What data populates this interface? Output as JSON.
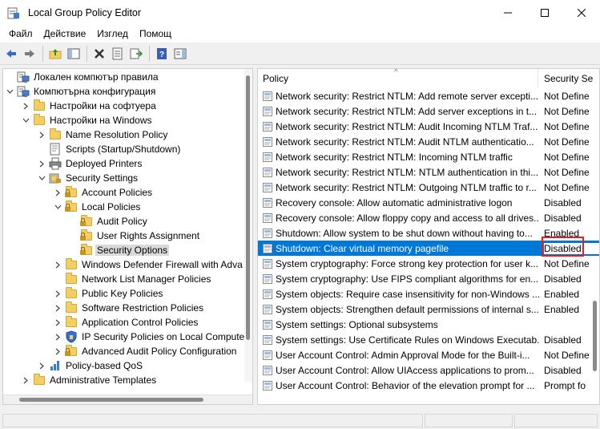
{
  "window": {
    "title": "Local Group Policy Editor"
  },
  "menu": [
    {
      "label": "Файл"
    },
    {
      "label": "Действие"
    },
    {
      "label": "Изглед"
    },
    {
      "label": "Помощ"
    }
  ],
  "tree": [
    {
      "label": "Локален компютър правила",
      "depth": 0,
      "icon": "computer-icon",
      "chevron": ""
    },
    {
      "label": "Компютърна конфигурация",
      "depth": 0,
      "icon": "computer-icon",
      "chevron": "down"
    },
    {
      "label": "Настройки на софтуера",
      "depth": 1,
      "icon": "folder-icon",
      "chevron": "right"
    },
    {
      "label": "Настройки на Windows",
      "depth": 1,
      "icon": "folder-icon",
      "chevron": "down"
    },
    {
      "label": "Name Resolution Policy",
      "depth": 2,
      "icon": "folder-icon",
      "chevron": "right"
    },
    {
      "label": "Scripts (Startup/Shutdown)",
      "depth": 2,
      "icon": "script-icon",
      "chevron": ""
    },
    {
      "label": "Deployed Printers",
      "depth": 2,
      "icon": "printer-icon",
      "chevron": "right"
    },
    {
      "label": "Security Settings",
      "depth": 2,
      "icon": "security-icon",
      "chevron": "down"
    },
    {
      "label": "Account Policies",
      "depth": 3,
      "icon": "locked-folder-icon",
      "chevron": "right"
    },
    {
      "label": "Local Policies",
      "depth": 3,
      "icon": "locked-folder-icon",
      "chevron": "down"
    },
    {
      "label": "Audit Policy",
      "depth": 4,
      "icon": "locked-folder-icon",
      "chevron": ""
    },
    {
      "label": "User Rights Assignment",
      "depth": 4,
      "icon": "locked-folder-icon",
      "chevron": ""
    },
    {
      "label": "Security Options",
      "depth": 4,
      "icon": "locked-folder-icon",
      "chevron": "",
      "selected": true
    },
    {
      "label": "Windows Defender Firewall with Adva",
      "depth": 3,
      "icon": "folder-icon",
      "chevron": "right"
    },
    {
      "label": "Network List Manager Policies",
      "depth": 3,
      "icon": "folder-icon",
      "chevron": ""
    },
    {
      "label": "Public Key Policies",
      "depth": 3,
      "icon": "folder-icon",
      "chevron": "right"
    },
    {
      "label": "Software Restriction Policies",
      "depth": 3,
      "icon": "folder-icon",
      "chevron": "right"
    },
    {
      "label": "Application Control Policies",
      "depth": 3,
      "icon": "folder-icon",
      "chevron": "right"
    },
    {
      "label": "IP Security Policies on Local Compute",
      "depth": 3,
      "icon": "ipsec-icon",
      "chevron": "right"
    },
    {
      "label": "Advanced Audit Policy Configuration",
      "depth": 3,
      "icon": "locked-folder-icon",
      "chevron": "right"
    },
    {
      "label": "Policy-based QoS",
      "depth": 2,
      "icon": "qos-icon",
      "chevron": "right"
    },
    {
      "label": "Administrative Templates",
      "depth": 1,
      "icon": "folder-icon",
      "chevron": "right"
    }
  ],
  "list": {
    "columns": {
      "policy": "Policy",
      "setting": "Security Se"
    },
    "rows": [
      {
        "policy": "Network security: Restrict NTLM: Add remote server excepti...",
        "setting": "Not Define"
      },
      {
        "policy": "Network security: Restrict NTLM: Add server exceptions in t...",
        "setting": "Not Define"
      },
      {
        "policy": "Network security: Restrict NTLM: Audit Incoming NTLM Traf...",
        "setting": "Not Define"
      },
      {
        "policy": "Network security: Restrict NTLM: Audit NTLM authenticatio...",
        "setting": "Not Define"
      },
      {
        "policy": "Network security: Restrict NTLM: Incoming NTLM traffic",
        "setting": "Not Define"
      },
      {
        "policy": "Network security: Restrict NTLM: NTLM authentication in thi...",
        "setting": "Not Define"
      },
      {
        "policy": "Network security: Restrict NTLM: Outgoing NTLM traffic to r...",
        "setting": "Not Define"
      },
      {
        "policy": "Recovery console: Allow automatic administrative logon",
        "setting": "Disabled"
      },
      {
        "policy": "Recovery console: Allow floppy copy and access to all drives...",
        "setting": "Disabled"
      },
      {
        "policy": "Shutdown: Allow system to be shut down without having to...",
        "setting": "Enabled"
      },
      {
        "policy": "Shutdown: Clear virtual memory pagefile",
        "setting": "Disabled",
        "selected": true
      },
      {
        "policy": "System cryptography: Force strong key protection for user k...",
        "setting": "Not Define"
      },
      {
        "policy": "System cryptography: Use FIPS compliant algorithms for en...",
        "setting": "Disabled"
      },
      {
        "policy": "System objects: Require case insensitivity for non-Windows ...",
        "setting": "Enabled"
      },
      {
        "policy": "System objects: Strengthen default permissions of internal s...",
        "setting": "Enabled"
      },
      {
        "policy": "System settings: Optional subsystems",
        "setting": ""
      },
      {
        "policy": "System settings: Use Certificate Rules on Windows Executab...",
        "setting": "Disabled"
      },
      {
        "policy": "User Account Control: Admin Approval Mode for the Built-i...",
        "setting": "Not Define"
      },
      {
        "policy": "User Account Control: Allow UIAccess applications to prom...",
        "setting": "Disabled"
      },
      {
        "policy": "User Account Control: Behavior of the elevation prompt for ...",
        "setting": "Prompt fo"
      }
    ]
  },
  "colors": {
    "selection": "#0078d7",
    "highlight_box": "#e02020",
    "folder": "#f3cf63"
  }
}
